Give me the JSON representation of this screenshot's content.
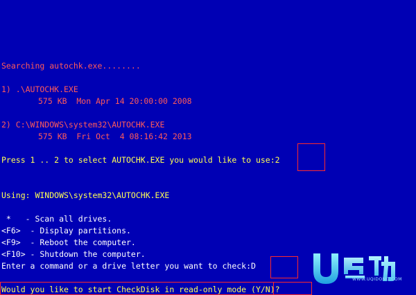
{
  "console": {
    "searching": "Searching autochk.exe........",
    "option1_path": "1) .\\AUTOCHK.EXE",
    "option1_info": "575 KB  Mon Apr 14 20:00:00 2008",
    "option2_path": "2) C:\\WINDOWS\\system32\\AUTOCHK.EXE",
    "option2_info": "575 KB  Fri Oct  4 08:16:42 2013",
    "select_prompt": "Press 1 .. 2 to select AUTOCHK.EXE you would like to use:",
    "select_answer": "2",
    "using": "Using: WINDOWS\\system32\\AUTOCHK.EXE",
    "menu": [
      " *   - Scan all drives.",
      "<F6>  - Display partitions.",
      "<F9>  - Reboot the computer.",
      "<F10> - Shutdown the computer."
    ],
    "drive_prompt": "Enter a command or a drive letter you want to check:",
    "drive_answer": "D",
    "readonly_prompt": "Would you like to start CheckDisk in read-only mode ",
    "readonly_choice": "(Y/N)",
    "readonly_suffix": "?"
  },
  "watermark": {
    "url_text": "WWW.UQIDONG.COM"
  },
  "colors": {
    "background": "#0000b4",
    "highlight_text": "#ff5a5a",
    "normal_text": "#ffff55",
    "highlight_frame": "#ff2a2a"
  }
}
